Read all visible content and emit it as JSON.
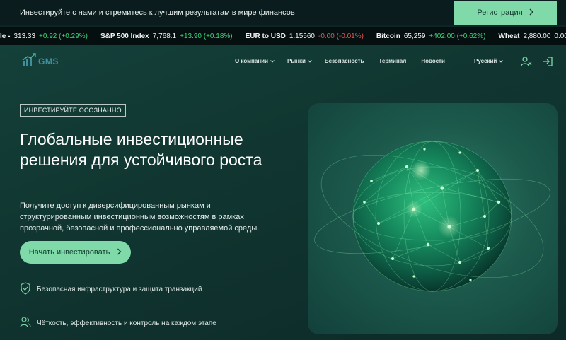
{
  "promo": {
    "text": "Инвестируйте с нами и стремитесь к лучшим результатам в мире финансов",
    "register_label": "Регистрация"
  },
  "ticker": [
    {
      "name": "le -",
      "price": "313.33",
      "change": "+0.92 (+0.29%)",
      "dir": "up"
    },
    {
      "name": "S&P 500 Index",
      "price": "7,768.1",
      "change": "+13.90 (+0.18%)",
      "dir": "up"
    },
    {
      "name": "EUR to USD",
      "price": "1.15560",
      "change": "-0.00 (-0.01%)",
      "dir": "down"
    },
    {
      "name": "Bitcoin",
      "price": "65,259",
      "change": "+402.00 (+0.62%)",
      "dir": "up"
    },
    {
      "name": "Wheat",
      "price": "2,880.00",
      "change": "0.00 (0",
      "dir": "flat"
    }
  ],
  "nav": {
    "logo_text": "GMS",
    "items": [
      {
        "label": "О компании",
        "dropdown": true
      },
      {
        "label": "Рынки",
        "dropdown": true
      },
      {
        "label": "Безопасность",
        "dropdown": false
      },
      {
        "label": "Терминал",
        "dropdown": false
      },
      {
        "label": "Новости",
        "dropdown": false
      }
    ],
    "language": "Русский"
  },
  "hero": {
    "badge": "ИНВЕСТИРУЙТЕ ОСОЗНАННО",
    "title": "Глобальные инвестиционные решения для устойчивого роста",
    "description": "Получите доступ к диверсифицированным рынкам и структурированным инвестиционным возможностям в рамках прозрачной, безопасной и профессионально управляемой среды.",
    "cta_label": "Начать инвестировать",
    "features": [
      {
        "icon": "shield-check-icon",
        "text": "Безопасная инфраструктура и защита транзакций"
      },
      {
        "icon": "users-icon",
        "text": "Чёткость, эффективность и контроль на каждом этапе"
      }
    ]
  },
  "colors": {
    "accent": "#7fd9a8",
    "background": "#0d2524",
    "positive": "#3fd47a",
    "negative": "#f05454"
  }
}
